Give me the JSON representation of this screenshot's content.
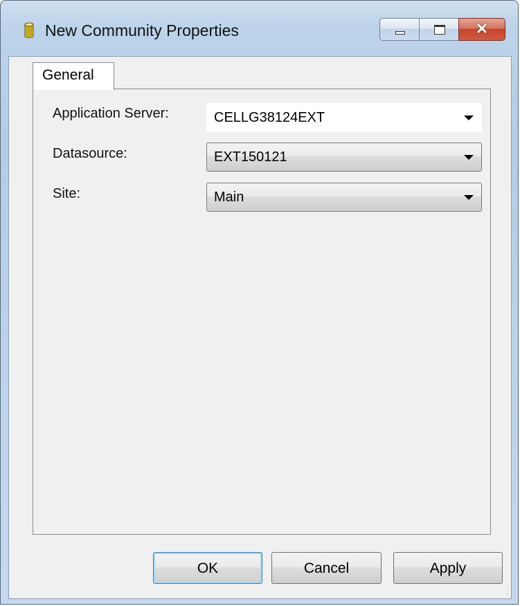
{
  "window": {
    "title": "New Community Properties",
    "icon": "database-cylinder-icon",
    "controls": {
      "minimize": "minimize-icon",
      "maximize": "maximize-icon",
      "close_glyph": "✕"
    }
  },
  "tabs": [
    {
      "label": "General",
      "selected": true
    }
  ],
  "form": {
    "app_server": {
      "label": "Application Server:",
      "value": "CELLG38124EXT"
    },
    "datasource": {
      "label": "Datasource:",
      "value": "EXT150121"
    },
    "site": {
      "label": "Site:",
      "value": "Main"
    }
  },
  "buttons": {
    "ok": "OK",
    "cancel": "Cancel",
    "apply": "Apply"
  },
  "colors": {
    "title_bar": "#c4d8ee",
    "client_bg": "#f0f0f0",
    "close_button": "#c6442b",
    "default_button_border": "#3c7fb1"
  }
}
